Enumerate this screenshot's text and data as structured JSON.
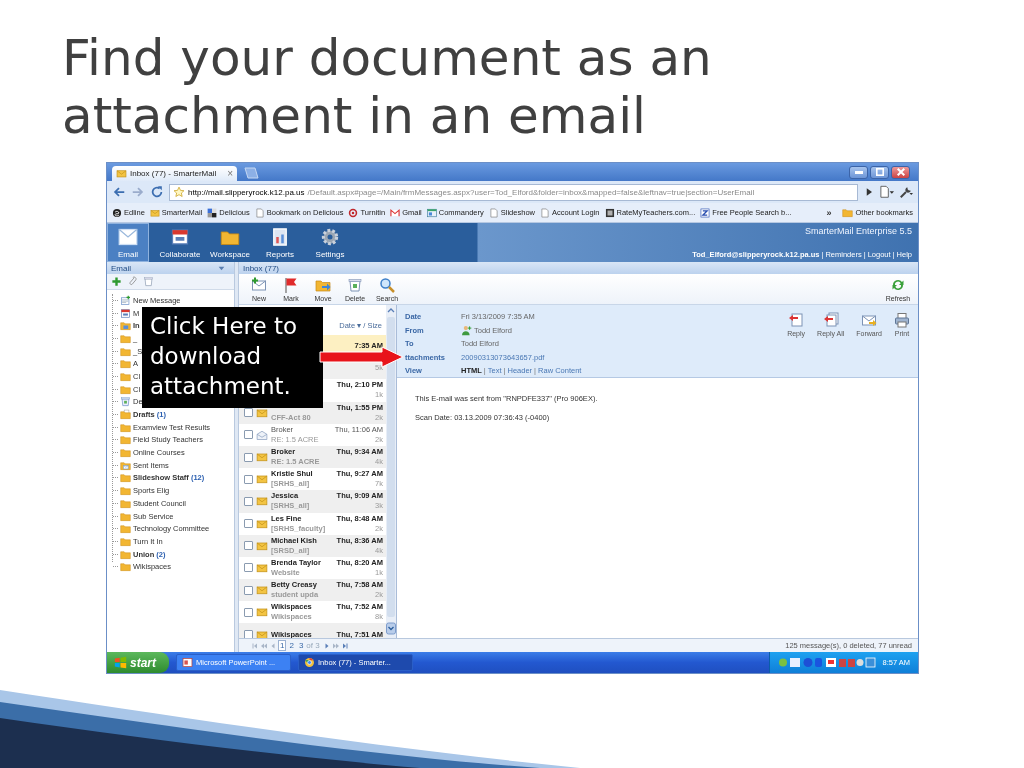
{
  "slide": {
    "title": "Find your document as an attachment in an email"
  },
  "browser": {
    "tab": {
      "title": "Inbox (77) - SmarterMail",
      "close": "×"
    },
    "url": {
      "host": "http://mail.slipperyrock.k12.pa.us",
      "path": "/Default.aspx#page=/Main/frmMessages.aspx?user=Tod_Elford&folder=inbox&mapped=false&leftnav=true|section=UserEmail"
    },
    "bookmarks": [
      {
        "label": "Edline",
        "kind": "logo"
      },
      {
        "label": "SmarterMail",
        "kind": "mail"
      },
      {
        "label": "Delicious",
        "kind": "squares"
      },
      {
        "label": "Bookmark on Delicious",
        "kind": "page"
      },
      {
        "label": "Turnitin",
        "kind": "ring"
      },
      {
        "label": "Gmail",
        "kind": "gmail"
      },
      {
        "label": "Commandery",
        "kind": "window"
      },
      {
        "label": "Slideshow",
        "kind": "page"
      },
      {
        "label": "Account Login",
        "kind": "page"
      },
      {
        "label": "RateMyTeachers.com...",
        "kind": "dark-square"
      },
      {
        "label": "Free People Search b...",
        "kind": "z-square"
      }
    ],
    "bookmarks_more": "»",
    "other_bookmarks": "Other bookmarks"
  },
  "app": {
    "nav": [
      {
        "label": "Email",
        "kind": "email",
        "selected": true
      },
      {
        "label": "Collaborate",
        "kind": "calendar",
        "selected": false
      },
      {
        "label": "Workspace",
        "kind": "folder",
        "selected": false
      },
      {
        "label": "Reports",
        "kind": "report",
        "selected": false
      },
      {
        "label": "Settings",
        "kind": "gear",
        "selected": false
      }
    ],
    "product": "SmarterMail Enterprise 5.5",
    "user": "Tod_Elford@slipperyrock.k12.pa.us",
    "links": [
      "Reminders",
      "Logout",
      "Help"
    ],
    "separator": "|"
  },
  "sidebar": {
    "title": "Email",
    "folders": [
      {
        "name": "New Message",
        "kind": "compose",
        "unread": false
      },
      {
        "name": "M",
        "kind": "calendar",
        "unread": false
      },
      {
        "name": "In",
        "kind": "inbox",
        "unread": true
      },
      {
        "name": "_",
        "kind": "folder",
        "unread": false
      },
      {
        "name": "_S",
        "kind": "folder",
        "unread": false
      },
      {
        "name": "A",
        "kind": "folder",
        "unread": false
      },
      {
        "name": "Cl",
        "kind": "folder",
        "unread": false
      },
      {
        "name": "Cl",
        "kind": "folder",
        "unread": false
      },
      {
        "name": "De",
        "kind": "deleted",
        "unread": false
      },
      {
        "name": "Drafts",
        "count": "(1)",
        "kind": "drafts",
        "unread": true
      },
      {
        "name": "Examview Test Results",
        "kind": "folder",
        "unread": false
      },
      {
        "name": "Field Study Teachers",
        "kind": "folder",
        "unread": false
      },
      {
        "name": "Online Courses",
        "kind": "folder",
        "unread": false
      },
      {
        "name": "Sent Items",
        "kind": "sent",
        "unread": false
      },
      {
        "name": "Slideshow Staff",
        "count": "(12)",
        "kind": "folder",
        "unread": true
      },
      {
        "name": "Sports Elig",
        "kind": "folder",
        "unread": false
      },
      {
        "name": "Student Council",
        "kind": "folder",
        "unread": false
      },
      {
        "name": "Sub Service",
        "kind": "folder",
        "unread": false
      },
      {
        "name": "Technology Committee",
        "kind": "folder",
        "unread": false
      },
      {
        "name": "Turn It In",
        "kind": "folder",
        "unread": false
      },
      {
        "name": "Union",
        "count": "(2)",
        "kind": "folder",
        "unread": true
      },
      {
        "name": "Wikispaces",
        "kind": "folder",
        "unread": false
      }
    ]
  },
  "inbox": {
    "title": "Inbox (77)",
    "tools": [
      {
        "label": "New",
        "kind": "new"
      },
      {
        "label": "Mark",
        "kind": "flag"
      },
      {
        "label": "Move",
        "kind": "move"
      },
      {
        "label": "Delete",
        "kind": "delete"
      },
      {
        "label": "Search",
        "kind": "search"
      }
    ],
    "refresh": "Refresh",
    "list_header": "Date ▾ / Size",
    "messages": [
      {
        "date": "7:35 AM",
        "selected": true,
        "unread": true
      },
      {
        "size": "5k",
        "selected": false
      },
      {
        "date": "Thu, 2:10 PM",
        "size": "1k",
        "selected": false,
        "unread": true
      },
      {
        "subject": "CFF-Act 80",
        "date": "Thu, 1:55 PM",
        "size": "2k",
        "selected": false,
        "unread": true
      },
      {
        "sender": "Broker",
        "subject": "RE: 1.5 ACRE",
        "date": "Thu, 11:06 AM",
        "size": "2k",
        "selected": false,
        "unread": false
      },
      {
        "sender": "Broker",
        "subject": "RE: 1.5 ACRE",
        "date": "Thu, 9:34 AM",
        "size": "4k",
        "selected": false,
        "unread": true
      },
      {
        "sender": "Kristie Shul",
        "subject": "[SRHS_all]",
        "date": "Thu, 9:27 AM",
        "size": "7k",
        "selected": false,
        "unread": true
      },
      {
        "sender": "Jessica",
        "subject": "[SRHS_all]",
        "date": "Thu, 9:09 AM",
        "size": "3k",
        "selected": false,
        "unread": true
      },
      {
        "sender": "Les Fine",
        "subject": "[SRHS_faculty]",
        "date": "Thu, 8:48 AM",
        "size": "2k",
        "selected": false,
        "unread": true
      },
      {
        "sender": "Michael Kish",
        "subject": "[SRSD_all]",
        "date": "Thu, 8:36 AM",
        "size": "4k",
        "selected": false,
        "unread": true
      },
      {
        "sender": "Brenda Taylor",
        "subject": "Website",
        "date": "Thu, 8:20 AM",
        "size": "1k",
        "selected": false,
        "unread": true
      },
      {
        "sender": "Betty Creasy",
        "subject": "student upda",
        "date": "Thu, 7:58 AM",
        "size": "2k",
        "selected": false,
        "unread": true
      },
      {
        "sender": "Wikispaces",
        "subject": "Wikispaces",
        "date": "Thu, 7:52 AM",
        "size": "8k",
        "selected": false,
        "unread": true
      },
      {
        "sender": "Wikispaces",
        "date": "Thu, 7:51 AM",
        "selected": false,
        "unread": true
      }
    ],
    "pages": [
      {
        "label": "1",
        "selected": true
      },
      {
        "label": "2",
        "selected": false
      },
      {
        "label": "3",
        "selected": false
      }
    ],
    "page_of": "of 3",
    "status": "125 message(s), 0 deleted, 77 unread"
  },
  "message": {
    "fields": [
      {
        "label": "Date",
        "value": "Fri 3/13/2009 7:35 AM",
        "kind": "text"
      },
      {
        "label": "From",
        "value": "Todd Elford",
        "kind": "contact"
      },
      {
        "label": "To",
        "value": "Todd Elford",
        "kind": "text"
      },
      {
        "label": "ttachments",
        "value": "20090313073643657.pdf",
        "kind": "link"
      },
      {
        "label": "View",
        "kind": "options",
        "separator": "|",
        "options": [
          {
            "label": "HTML",
            "selected": true
          },
          {
            "label": "Text",
            "selected": false
          },
          {
            "label": "Header",
            "selected": false
          },
          {
            "label": "Raw Content",
            "selected": false
          }
        ]
      }
    ],
    "actions": [
      {
        "label": "Reply",
        "kind": "reply"
      },
      {
        "label": "Reply All",
        "kind": "replyall"
      },
      {
        "label": "Forward",
        "kind": "forward"
      },
      {
        "label": "Print",
        "kind": "print"
      }
    ],
    "body": [
      "This E-mail was sent from \"RNPDFE337\" (Pro 906EX).",
      "Scan Date: 03.13.2009 07:36:43 (-0400)"
    ]
  },
  "taskbar": {
    "start": "start",
    "tasks": [
      {
        "label": "Microsoft PowerPoint ...",
        "kind": "slide",
        "selected": false
      },
      {
        "label": "Inbox (77) - Smarter...",
        "kind": "browser",
        "selected": true
      }
    ],
    "clock": "8:57 AM"
  },
  "callout": {
    "text": "Click Here to download attachment."
  }
}
